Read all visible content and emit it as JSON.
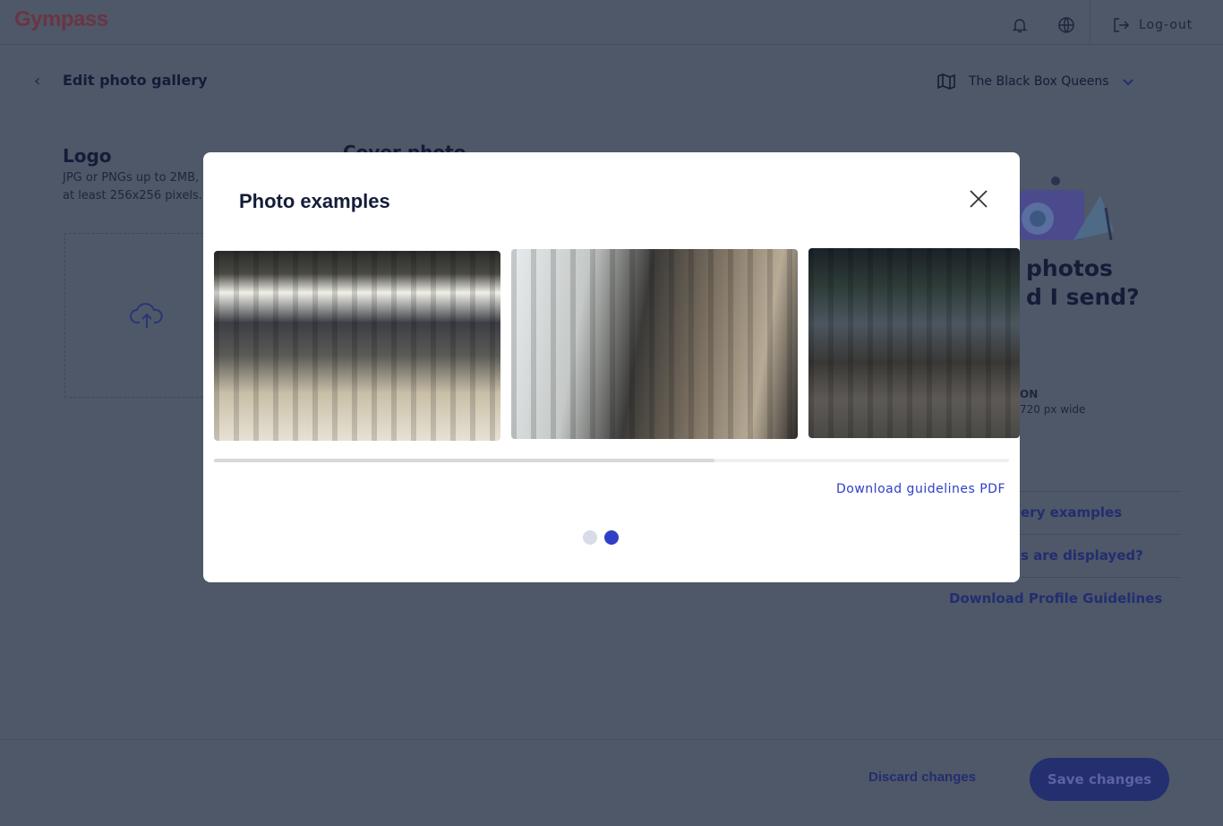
{
  "header": {
    "logo": "Gympass",
    "logout_label": "Log-out",
    "icons": [
      "bell-icon",
      "globe-icon",
      "logout-icon"
    ]
  },
  "page": {
    "title": "Edit photo gallery",
    "gym_name": "The Black Box Queens"
  },
  "logo_section": {
    "title": "Logo",
    "desc_line1": "JPG or PNGs up to 2MB,",
    "desc_line2": "at least 256x256 pixels."
  },
  "cover_section": {
    "title": "Cover photo"
  },
  "help": {
    "title_line1": "photos",
    "title_line2": "d I send?",
    "res_label": "ON",
    "res_desc": "720 px wide",
    "links": [
      "ery examples",
      "s are displayed?",
      "Download Profile Guidelines"
    ]
  },
  "footer": {
    "discard": "Discard changes",
    "save": "Save changes"
  },
  "modal": {
    "title": "Photo examples",
    "download_link": "Download guidelines PDF",
    "scroll_progress_percent": 63,
    "pages": 2,
    "active_page": 2,
    "photos": [
      "gym-floor-with-palm-tree",
      "gym-machines-by-windows",
      "gym-boxing-area"
    ]
  },
  "colors": {
    "accent": "#2f3ec8",
    "overlay": "#4e5868",
    "brand": "#6b3444"
  }
}
